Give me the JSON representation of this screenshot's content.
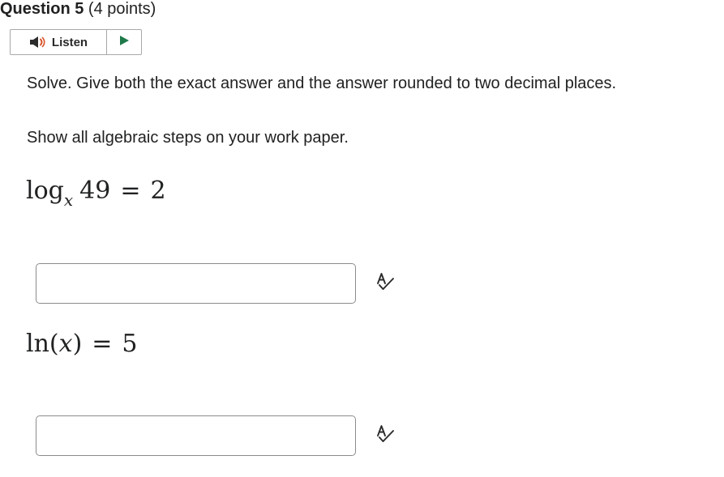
{
  "question": {
    "title": "Question 5",
    "points": "(4 points)"
  },
  "listen": {
    "label": "Listen",
    "speaker_icon": "speaker-icon",
    "play_icon": "play-icon"
  },
  "instructions": "Solve. Give both the exact answer and the answer rounded to two decimal places.",
  "steps_note": "Show all algebraic steps on your work paper.",
  "equations": [
    {
      "func": "log",
      "base": "x",
      "arg": "49",
      "equals": "=",
      "rhs": "2"
    },
    {
      "func": "ln",
      "open": "(",
      "var": "x",
      "close": ")",
      "equals": "=",
      "rhs": "5"
    }
  ],
  "answers": [
    {
      "value": "",
      "placeholder": ""
    },
    {
      "value": "",
      "placeholder": ""
    }
  ],
  "spellcheck_icon": "spellcheck-icon",
  "colors": {
    "text": "#202122",
    "border": "#8c8c8c",
    "speaker_accent": "#d9542b"
  }
}
